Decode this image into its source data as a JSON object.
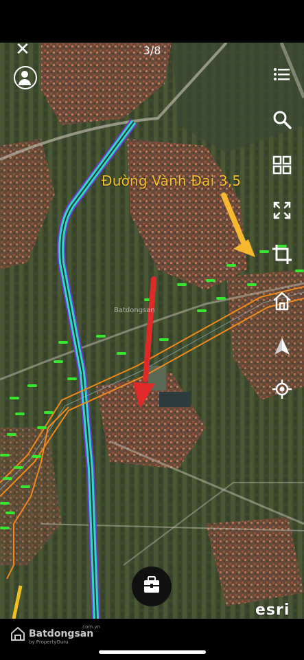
{
  "viewer": {
    "counter": "3/8",
    "close_icon": "close-icon",
    "avatar_icon": "avatar-icon"
  },
  "map": {
    "road_label": "Đường Vành Đai 3,5",
    "watermark": "Batdongsan",
    "attribution": "esri",
    "colors": {
      "road_label": "#f2c02e",
      "yellow_arrow": "#f5b82e",
      "red_arrow": "#e02a2a",
      "expressway": "#35d6c4",
      "planned_road": "#f08a1e",
      "parcel_labels": "#37e62f"
    }
  },
  "sidebar": [
    {
      "name": "layers-list-icon",
      "icon": "list-icon"
    },
    {
      "name": "search-icon",
      "icon": "search-icon"
    },
    {
      "name": "grid-icon",
      "icon": "grid-icon"
    },
    {
      "name": "fullscreen-icon",
      "icon": "expand-icon"
    },
    {
      "name": "crop-icon",
      "icon": "crop-icon"
    },
    {
      "name": "home-icon",
      "icon": "home-icon"
    },
    {
      "name": "north-arrow-icon",
      "icon": "compass-icon"
    },
    {
      "name": "locate-icon",
      "icon": "target-icon"
    }
  ],
  "fab": {
    "icon": "briefcase-icon"
  },
  "footer": {
    "brand": "Batdongsan",
    "brand_domain": ".com.vn",
    "brand_sub": "by PropertyGuru"
  }
}
